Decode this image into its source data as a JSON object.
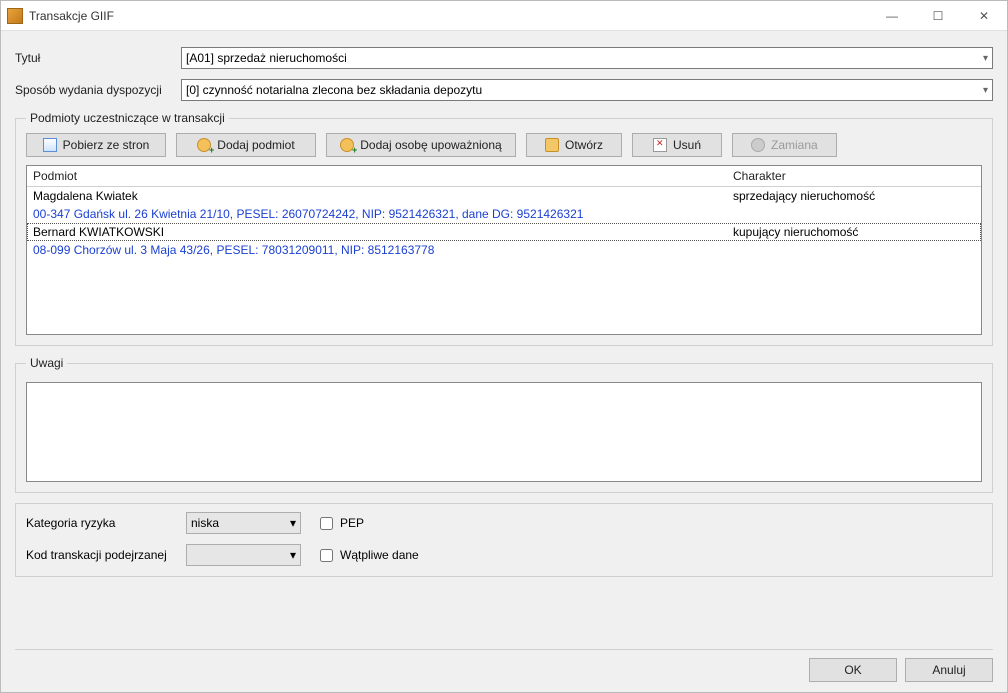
{
  "window": {
    "title": "Transakcje GIIF"
  },
  "fields": {
    "title_label": "Tytuł",
    "title_value": "[A01] sprzedaż nieruchomości",
    "method_label": "Sposób wydania dyspozycji",
    "method_value": "[0] czynność notarialna zlecona bez składania depozytu"
  },
  "parties": {
    "legend": "Podmioty uczestniczące w transakcji",
    "buttons": {
      "fetch": "Pobierz ze stron",
      "add_entity": "Dodaj podmiot",
      "add_person": "Dodaj osobę upoważnioną",
      "open": "Otwórz",
      "delete": "Usuń",
      "swap": "Zamiana"
    },
    "headers": {
      "entity": "Podmiot",
      "role": "Charakter"
    },
    "rows": [
      {
        "name": "Magdalena Kwiatek",
        "role": "sprzedający nieruchomość",
        "detail": "00-347 Gdańsk ul. 26 Kwietnia 21/10, PESEL: 26070724242, NIP: 9521426321, dane DG: 9521426321",
        "selected": false
      },
      {
        "name": "Bernard KWIATKOWSKI",
        "role": "kupujący nieruchomość",
        "detail": "08-099 Chorzów ul. 3 Maja 43/26, PESEL: 78031209011, NIP: 8512163778",
        "selected": true
      }
    ]
  },
  "remarks": {
    "legend": "Uwagi",
    "value": ""
  },
  "risk": {
    "category_label": "Kategoria ryzyka",
    "category_value": "niska",
    "pep_label": "PEP",
    "code_label": "Kod transkacji podejrzanej",
    "code_value": "",
    "doubt_label": "Wątpliwe dane"
  },
  "footer": {
    "ok": "OK",
    "cancel": "Anuluj"
  }
}
